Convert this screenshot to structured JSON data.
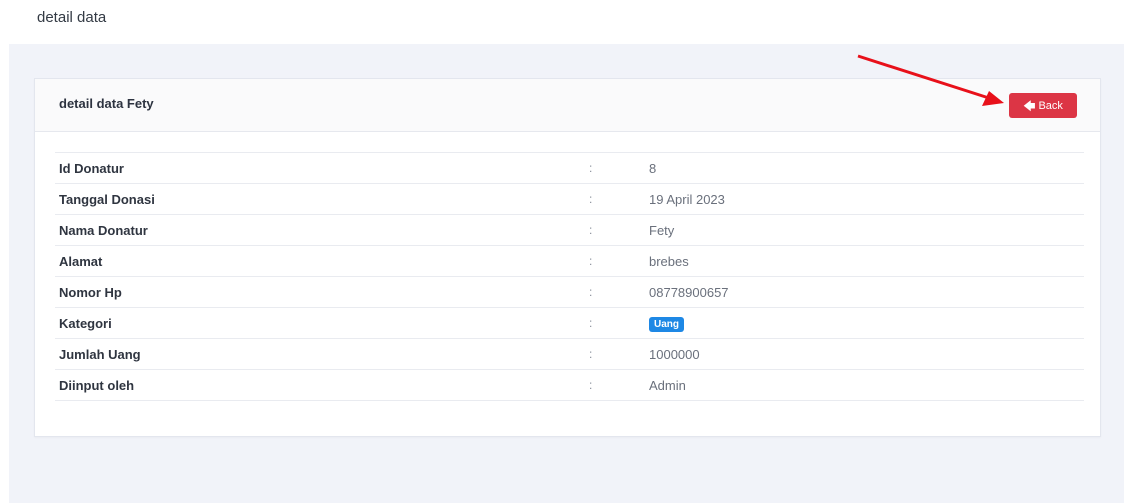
{
  "page": {
    "title": "detail data"
  },
  "card": {
    "title": "detail data Fety",
    "back_label": "Back"
  },
  "rows": [
    {
      "label": "Id Donatur",
      "sep": ":",
      "value": "8"
    },
    {
      "label": "Tanggal Donasi",
      "sep": ":",
      "value": "19 April 2023"
    },
    {
      "label": "Nama Donatur",
      "sep": ":",
      "value": "Fety"
    },
    {
      "label": "Alamat",
      "sep": ":",
      "value": "brebes"
    },
    {
      "label": "Nomor Hp",
      "sep": ":",
      "value": "08778900657"
    },
    {
      "label": "Kategori",
      "sep": ":",
      "value": "Uang"
    },
    {
      "label": "Jumlah Uang",
      "sep": ":",
      "value": "1000000"
    },
    {
      "label": "Diinput oleh",
      "sep": ":",
      "value": "Admin"
    }
  ],
  "colors": {
    "back_button": "#dc3545",
    "badge": "#1e88e5",
    "annotation_arrow": "#e8101a"
  }
}
